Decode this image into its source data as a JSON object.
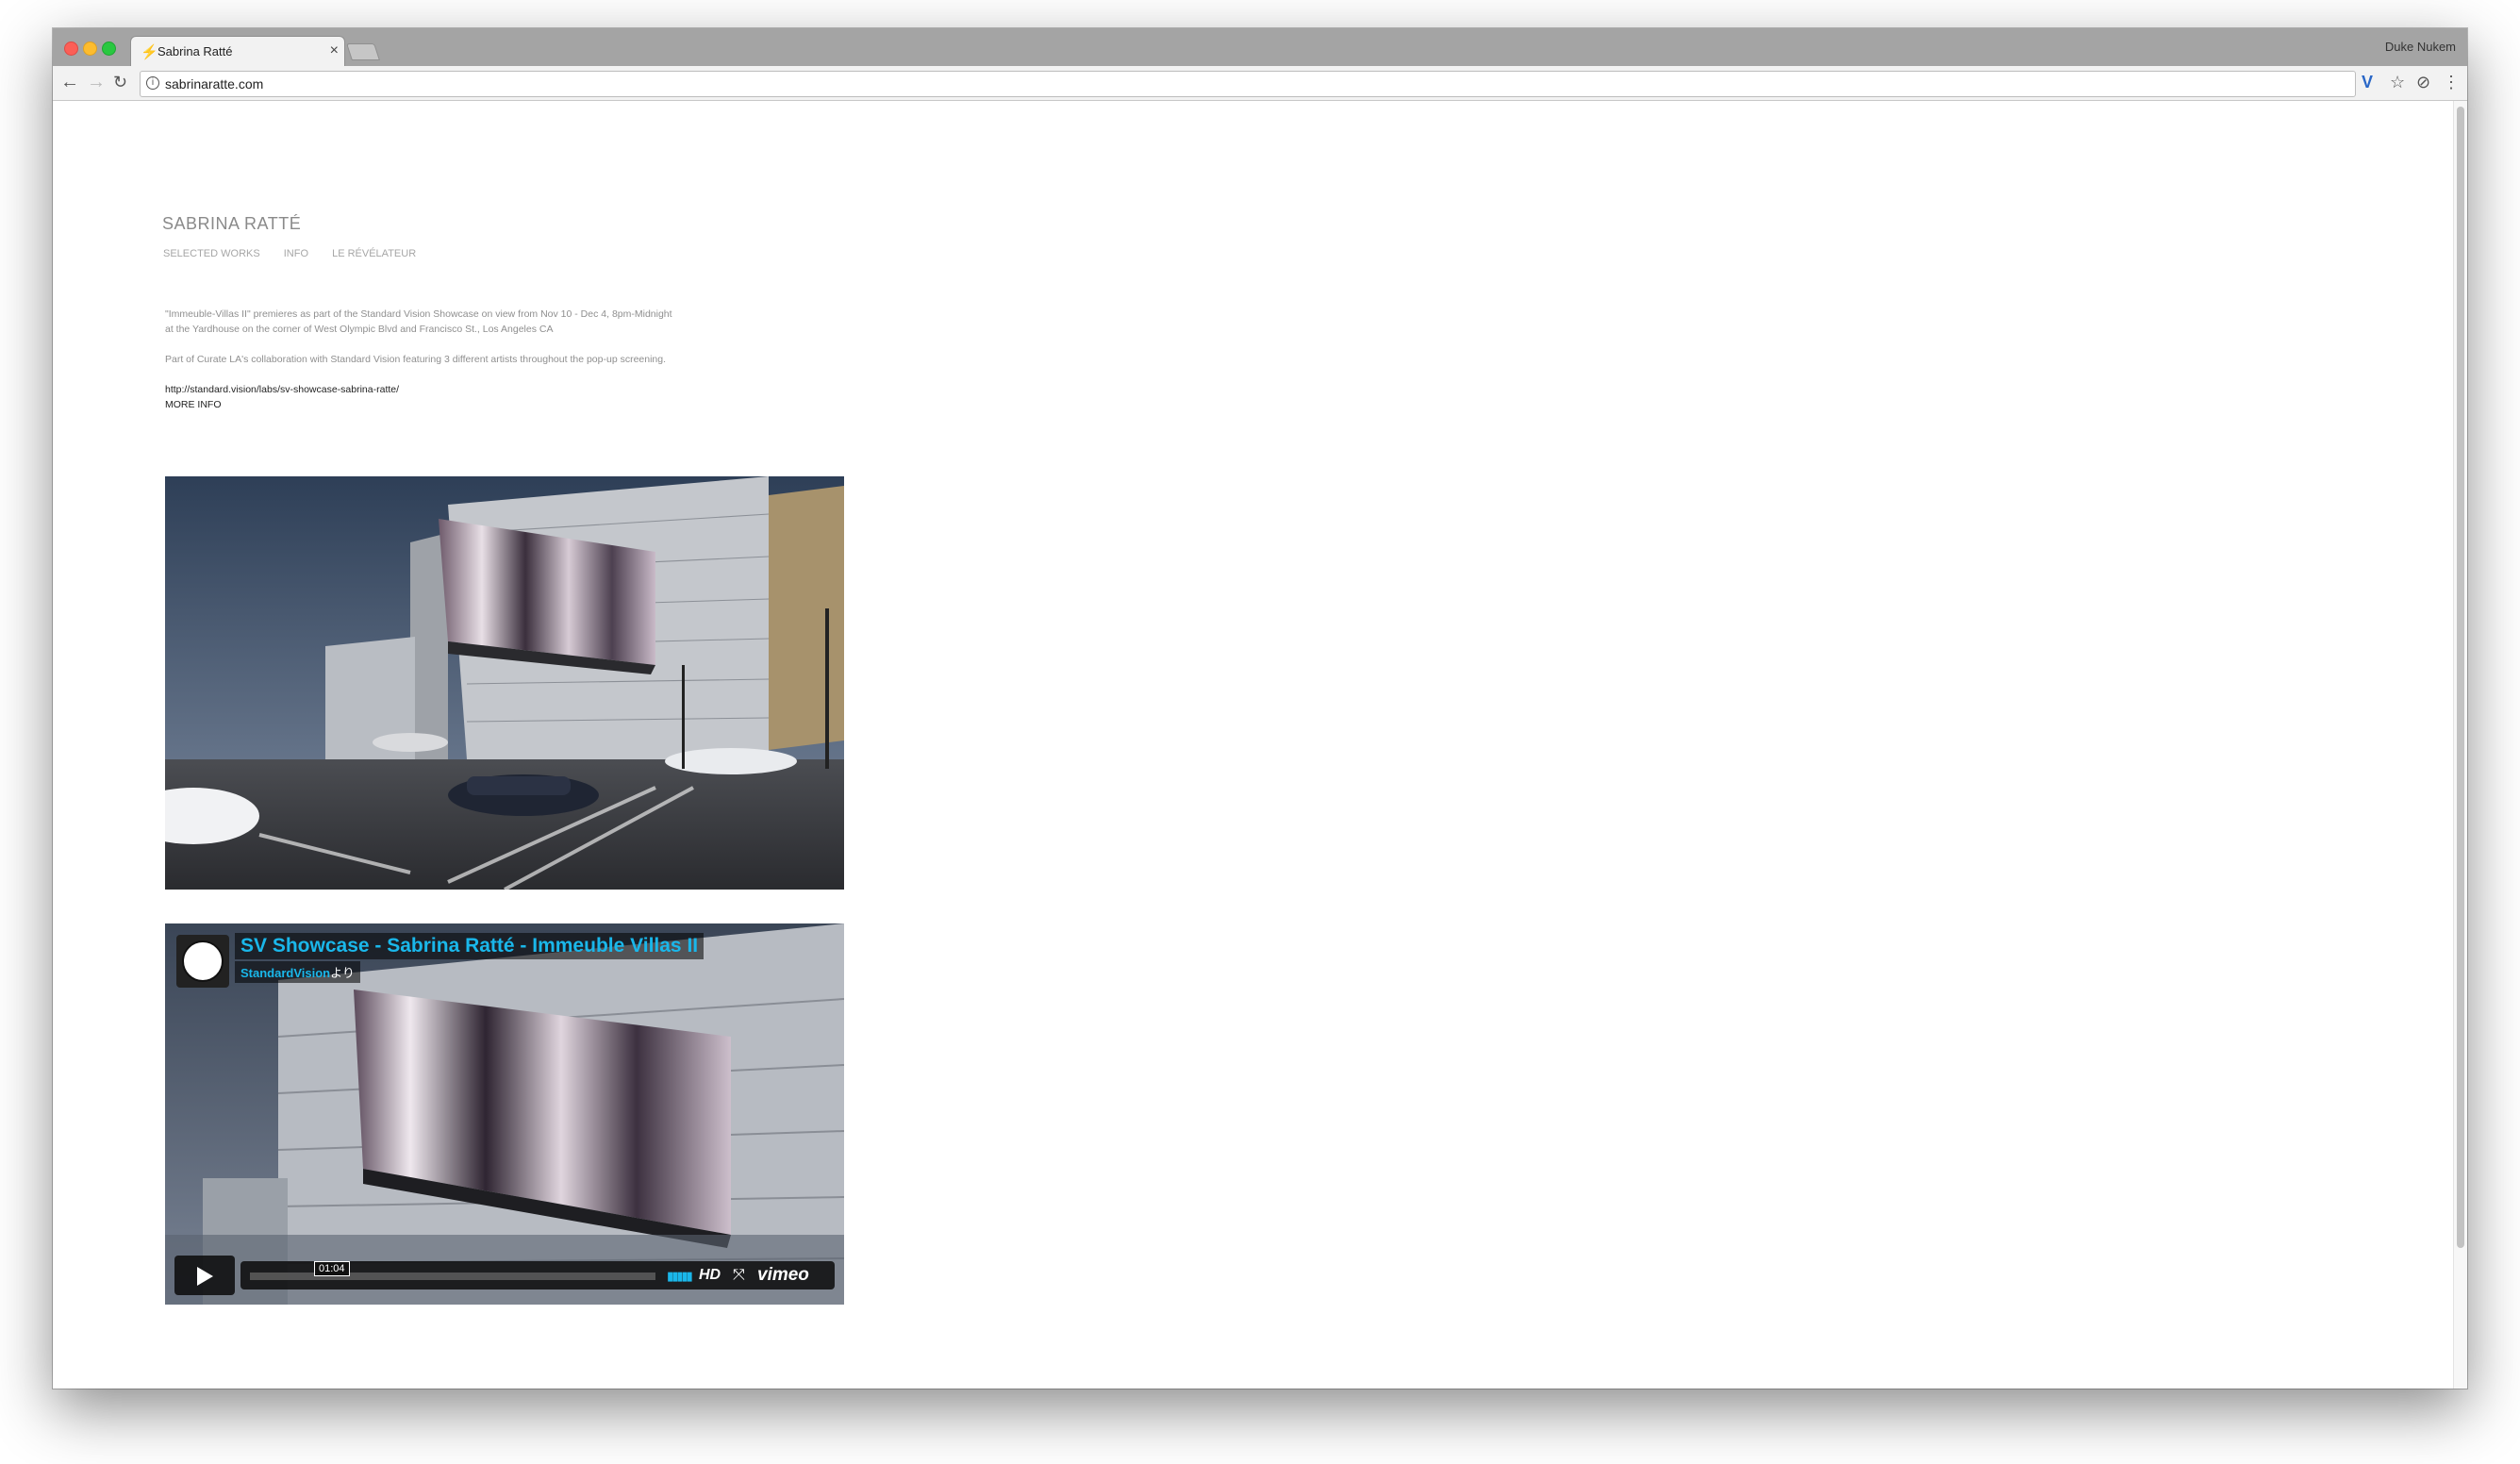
{
  "browser": {
    "tab_title": "Sabrina Ratté",
    "profile_name": "Duke Nukem",
    "url": "sabrinaratte.com",
    "favicon_icon": "lightning-icon"
  },
  "site": {
    "title": "SABRINA RATTÉ",
    "nav": [
      "SELECTED WORKS",
      "INFO",
      "LE RÉVÉLATEUR"
    ]
  },
  "post": {
    "paragraph1_line1": "\"Immeuble-Villas II\" premieres as part of the Standard Vision Showcase on view from Nov 10 - Dec 4, 8pm-Midnight",
    "paragraph1_line2": "at the Yardhouse on the corner of West Olympic Blvd and Francisco St., Los Angeles CA",
    "paragraph2": "Part of Curate LA's collaboration with Standard Vision featuring 3 different artists throughout the pop-up screening.",
    "link": "http://standard.vision/labs/sv-showcase-sabrina-ratte/",
    "more_info": "MORE INFO"
  },
  "video": {
    "title": "SV Showcase - Sabrina Ratté - Immeuble Villas II",
    "owner": "StandardVision",
    "byline_suffix": "より",
    "time": "01:04",
    "hd_label": "HD",
    "logo": "vimeo"
  },
  "colors": {
    "vimeo_blue": "#1ab7ea",
    "tabstrip": "#a4a4a4"
  }
}
